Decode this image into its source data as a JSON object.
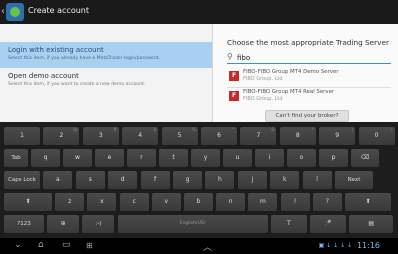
{
  "app": {
    "back": "‹",
    "title": "Create account"
  },
  "left_options": [
    {
      "title": "Login with existing account",
      "subtitle": "Select this item, if you already have a MetaTrader login/password."
    },
    {
      "title": "Open demo account",
      "subtitle": "Select this item, if you want to create a new demo account."
    }
  ],
  "server_panel": {
    "title": "Choose the most appropriate Trading Server",
    "search_value": "fibo",
    "servers": [
      {
        "name": "FIBO-FIBO Group MT4 Demo Server",
        "company": "FIBO Group, Ltd",
        "icon": "F"
      },
      {
        "name": "FIBO-FIBO Group MT4 Real Server",
        "company": "FIBO Group, Ltd",
        "icon": "F"
      }
    ],
    "find_button": "Can't find your broker?"
  },
  "keyboard": {
    "row1": [
      {
        "k": "1",
        "s": ""
      },
      {
        "k": "2",
        "s": "@"
      },
      {
        "k": "3",
        "s": "#"
      },
      {
        "k": "4",
        "s": "$"
      },
      {
        "k": "5",
        "s": "%"
      },
      {
        "k": "6",
        "s": "^"
      },
      {
        "k": "7",
        "s": "&"
      },
      {
        "k": "8",
        "s": "*"
      },
      {
        "k": "9",
        "s": "("
      },
      {
        "k": "0",
        "s": ")"
      }
    ],
    "row2": [
      "Tab",
      "q",
      "w",
      "e",
      "r",
      "t",
      "y",
      "u",
      "i",
      "o",
      "p",
      "⌫"
    ],
    "row3": [
      "Caps Lock",
      "a",
      "s",
      "d",
      "f",
      "g",
      "h",
      "j",
      "k",
      "l",
      "Next"
    ],
    "row4": [
      "⬆",
      "z",
      "x",
      "c",
      "v",
      "b",
      "n",
      "m",
      "!",
      "?",
      "⬆"
    ],
    "row5": [
      "?123",
      "⊕",
      ":-)",
      "English(US)",
      "T",
      "🎤",
      "▤"
    ]
  },
  "navbar": {
    "back": "⌄",
    "home": "⌂",
    "recent": "▭",
    "screenshot": "⊞",
    "up": "︿",
    "time": "11:16",
    "status": "▣ ↓ ↓ ↓ ↓"
  }
}
